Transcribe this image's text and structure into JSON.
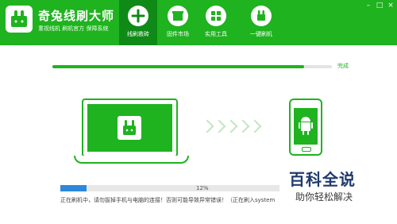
{
  "header": {
    "app_title": "奇兔线刷大师",
    "app_subtitle": "重视线机  刷机官方  保障系统",
    "tabs": [
      {
        "label": "线刷救砖"
      },
      {
        "label": "固件市场"
      },
      {
        "label": "实用工具"
      },
      {
        "label": "一键刷机"
      }
    ],
    "window_buttons": [
      "–",
      "□",
      "×"
    ]
  },
  "progress_top": {
    "label": "完成",
    "value": 0.9
  },
  "progress_bottom": {
    "percent_text": "12%",
    "value": 0.12,
    "status_text": "正在刷机中，请勿拔掉手机与电脑的连接！否则可能导致异常错误！（正在刷入system"
  },
  "watermark": {
    "line1": "百科全说",
    "line2": "助你轻松解决"
  },
  "colors": {
    "brand_green": "#1fb31f",
    "active_tab": "#0f8a17",
    "progress_blue": "#2d88d9"
  },
  "icons": {
    "logo": "rabbit-logo-icon",
    "tab_icons": [
      "wrench-cross-icon",
      "store-icon",
      "grid-icon",
      "rabbit-flash-icon"
    ],
    "phone": "android-icon"
  }
}
